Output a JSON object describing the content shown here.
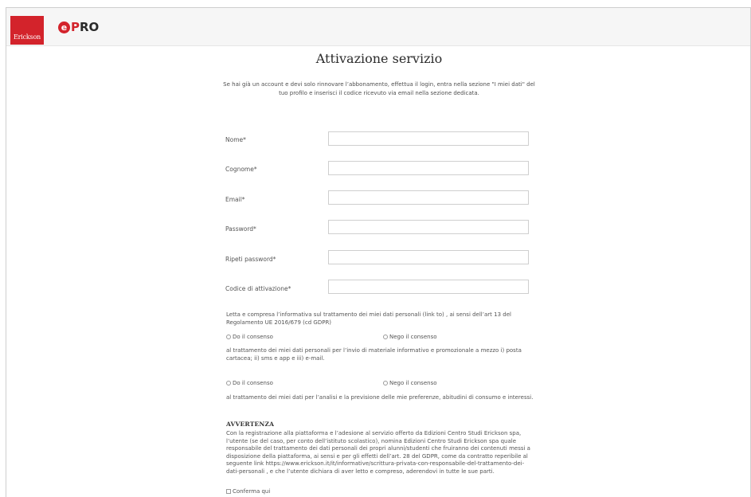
{
  "header": {
    "logo_erickson": "Erickson",
    "logo_epro_e": "e",
    "logo_epro_p": "P",
    "logo_epro_ro": "RO",
    "brand_color": "#d3232b"
  },
  "page": {
    "title": "Attivazione servizio",
    "intro": "Se hai già un account e devi solo rinnovare l’abbonamento, effettua il login, entra nella sezione \"I miei dati\" del tuo profilo e inserisci il codice ricevuto via email nella sezione dedicata."
  },
  "form": {
    "fields": [
      {
        "label": "Nome*",
        "value": ""
      },
      {
        "label": "Cognome*",
        "value": ""
      },
      {
        "label": "Email*",
        "value": ""
      },
      {
        "label": "Password*",
        "value": ""
      },
      {
        "label": "Ripeti password*",
        "value": ""
      },
      {
        "label": "Codice di attivazione*",
        "value": ""
      }
    ],
    "privacy_text": "Letta e compresa l’informativa sul trattamento dei miei dati personali (link to) , ai sensi dell’art 13 del Regolamento UE 2016/679 (cd GDPR)",
    "consent1": {
      "yes": "Do il consenso",
      "no": "Nego il consenso"
    },
    "marketing_text": "al trattamento dei miei dati personali per l’invio di materiale informativo e promozionale a mezzo i) posta cartacea; ii) sms e app e iii) e-mail.",
    "consent2": {
      "yes": "Do il consenso",
      "no": "Nego il consenso"
    },
    "profiling_text": "al trattamento dei miei dati per l’analisi e la previsione delle mie preferenze, abitudini di consumo e interessi.",
    "warning_title": "AVVERTENZA",
    "warning_text": "Con la registrazione alla piattaforma e l’adesione al servizio offerto da Edizioni Centro Studi Erickson spa, l’utente (se del caso, per conto dell’istituto scolastico), nomina Edizioni Centro Studi Erickson spa quale responsabile del trattamento dei dati personali dei propri alunni/studenti che fruiranno dei contenuti messi a disposizione della piattaforma, ai sensi e per gli effetti dell’art. 28 del GDPR, come da contratto reperibile al seguente link https://www.erickson.it/it/informative/scrittura-privata-con-responsabile-del-trattamento-dei-dati-personali , e che l’utente dichiara di aver letto e compreso, aderendovi in tutte le sue parti.",
    "confirm_label": "Conferma qui"
  }
}
